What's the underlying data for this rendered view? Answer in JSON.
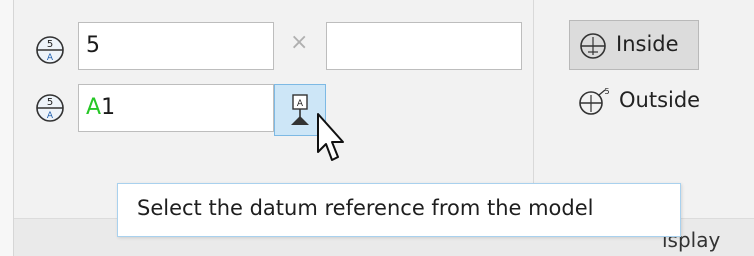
{
  "panel": {
    "row1_value": "5",
    "row2_value_prefix": "A",
    "row2_value_suffix": "1",
    "row1_second_value": "",
    "separator": "×"
  },
  "placement": {
    "inside_label": "Inside",
    "outside_label": "Outside"
  },
  "tooltip": {
    "text": "Select the datum reference from the model"
  },
  "group": {
    "label_fragment": "isplay"
  },
  "icons": {
    "row1_symbol": "datum-target-icon",
    "row2_symbol": "datum-target-icon",
    "pick_reference": "datum-reference-pick-icon",
    "inside": "datum-target-inside-icon",
    "outside": "datum-target-outside-icon",
    "cursor": "mouse-pointer-icon"
  },
  "colors": {
    "accent_letter": "#26c726",
    "active_button_bg": "#cde6f7",
    "tooltip_border": "#a9d1ee"
  }
}
